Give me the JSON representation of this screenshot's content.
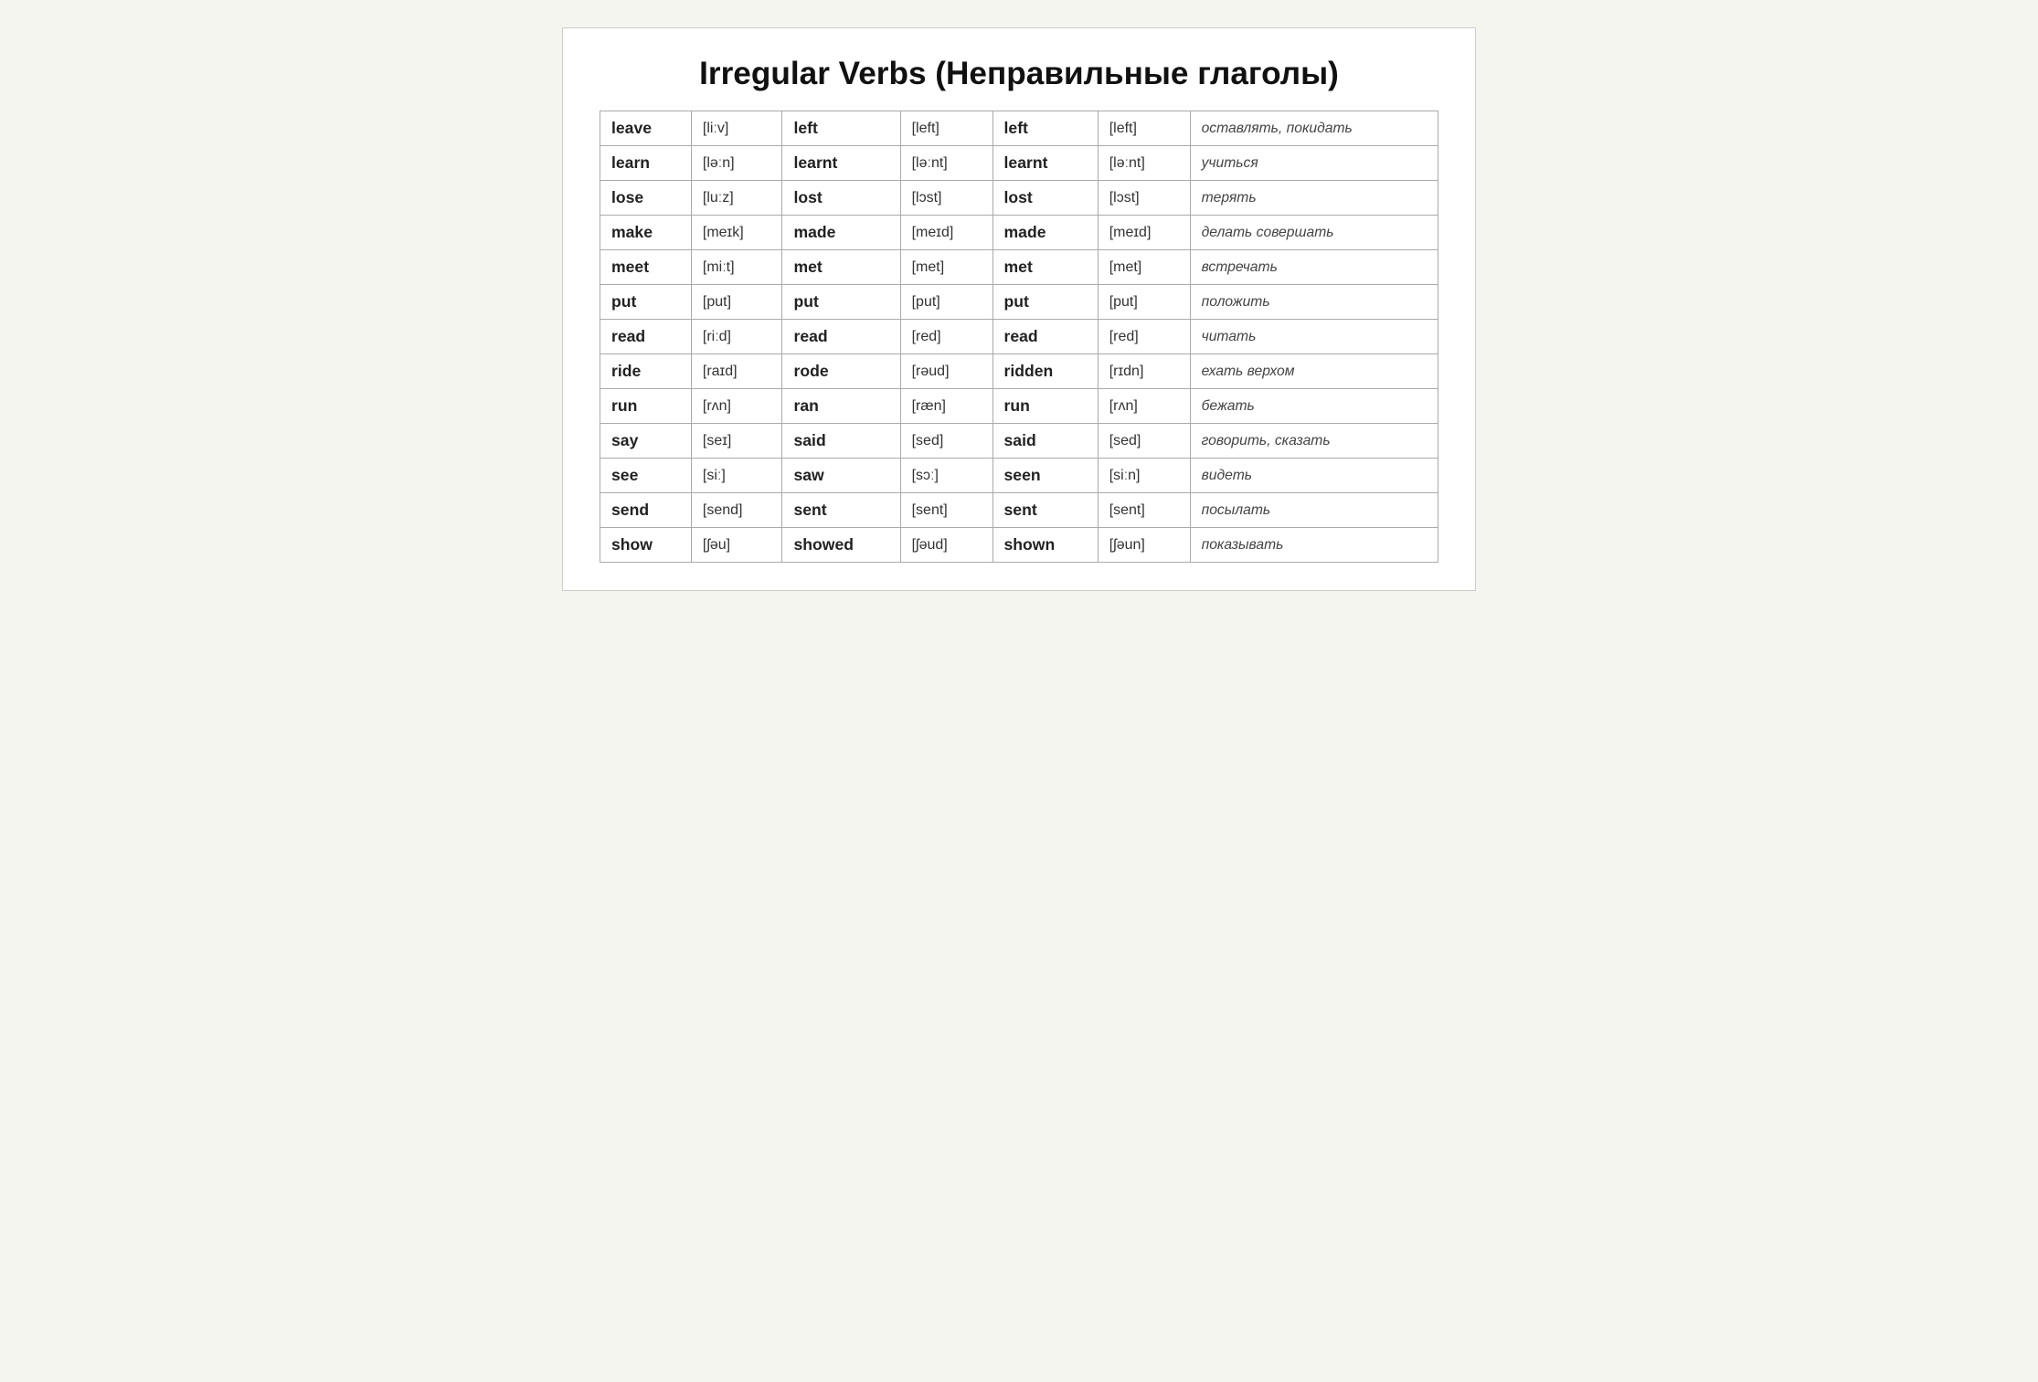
{
  "title": "Irregular Verbs (Неправильные глаголы)",
  "table": {
    "rows": [
      {
        "base": "leave",
        "base_phonetic": "[liːv]",
        "past_simple": "left",
        "past_simple_phonetic": "[left]",
        "past_participle": "left",
        "past_participle_phonetic": "[left]",
        "translation": "оставлять, покидать"
      },
      {
        "base": "learn",
        "base_phonetic": "[ləːn]",
        "past_simple": "learnt",
        "past_simple_phonetic": "[ləːnt]",
        "past_participle": "learnt",
        "past_participle_phonetic": "[ləːnt]",
        "translation": "учиться"
      },
      {
        "base": "lose",
        "base_phonetic": "[luːz]",
        "past_simple": "lost",
        "past_simple_phonetic": "[lɔst]",
        "past_participle": "lost",
        "past_participle_phonetic": "[lɔst]",
        "translation": "терять"
      },
      {
        "base": "make",
        "base_phonetic": "[meɪk]",
        "past_simple": "made",
        "past_simple_phonetic": "[meɪd]",
        "past_participle": "made",
        "past_participle_phonetic": "[meɪd]",
        "translation": "делать совершать"
      },
      {
        "base": "meet",
        "base_phonetic": "[miːt]",
        "past_simple": "met",
        "past_simple_phonetic": "[met]",
        "past_participle": "met",
        "past_participle_phonetic": "[met]",
        "translation": "встречать"
      },
      {
        "base": "put",
        "base_phonetic": "[put]",
        "past_simple": "put",
        "past_simple_phonetic": "[put]",
        "past_participle": "put",
        "past_participle_phonetic": "[put]",
        "translation": "положить"
      },
      {
        "base": "read",
        "base_phonetic": "[riːd]",
        "past_simple": "read",
        "past_simple_phonetic": "[red]",
        "past_participle": "read",
        "past_participle_phonetic": "[red]",
        "translation": "читать"
      },
      {
        "base": "ride",
        "base_phonetic": "[raɪd]",
        "past_simple": "rode",
        "past_simple_phonetic": "[rəud]",
        "past_participle": "ridden",
        "past_participle_phonetic": "[rɪdn]",
        "translation": "ехать верхом"
      },
      {
        "base": "run",
        "base_phonetic": "[rʌn]",
        "past_simple": "ran",
        "past_simple_phonetic": "[ræn]",
        "past_participle": "run",
        "past_participle_phonetic": "[rʌn]",
        "translation": "бежать"
      },
      {
        "base": "say",
        "base_phonetic": "[seɪ]",
        "past_simple": "said",
        "past_simple_phonetic": "[sed]",
        "past_participle": "said",
        "past_participle_phonetic": "[sed]",
        "translation": "говорить, сказать"
      },
      {
        "base": "see",
        "base_phonetic": "[siː]",
        "past_simple": "saw",
        "past_simple_phonetic": "[sɔː]",
        "past_participle": "seen",
        "past_participle_phonetic": "[siːn]",
        "translation": "видеть"
      },
      {
        "base": "send",
        "base_phonetic": "[send]",
        "past_simple": "sent",
        "past_simple_phonetic": "[sent]",
        "past_participle": "sent",
        "past_participle_phonetic": "[sent]",
        "translation": "посылать"
      },
      {
        "base": "show",
        "base_phonetic": "[ʃəu]",
        "past_simple": "showed",
        "past_simple_phonetic": "[ʃəud]",
        "past_participle": "shown",
        "past_participle_phonetic": "[ʃəun]",
        "translation": "показывать"
      }
    ]
  }
}
